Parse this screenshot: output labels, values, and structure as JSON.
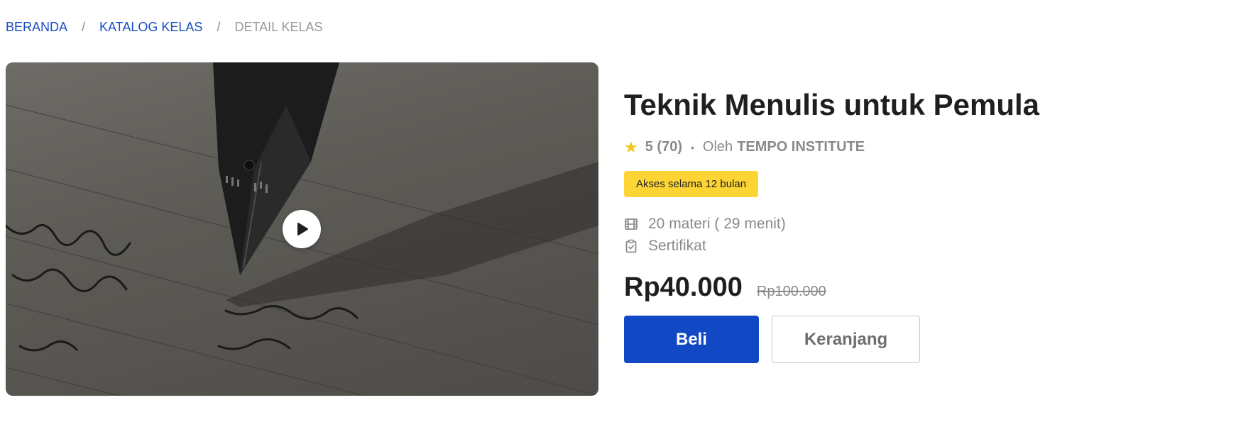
{
  "breadcrumb": {
    "home": "BERANDA",
    "catalog": "KATALOG KELAS",
    "current": "DETAIL KELAS",
    "separator": "/"
  },
  "course": {
    "title": "Teknik Menulis untuk Pemula",
    "rating": "5 (70)",
    "instructor_prefix": "Oleh",
    "instructor": "TEMPO INSTITUTE",
    "access_badge": "Akses selama 12 bulan",
    "materials": "20 materi ( 29 menit)",
    "certificate": "Sertifikat",
    "price": "Rp40.000",
    "original_price": "Rp100.000"
  },
  "actions": {
    "buy_label": "Beli",
    "cart_label": "Keranjang"
  },
  "icons": {
    "rating": "star-icon",
    "materials": "film-icon",
    "certificate": "clipboard-check-icon",
    "video": "play-icon"
  },
  "colors": {
    "primary": "#1148c4",
    "link": "#1a4fc4",
    "badge": "#fcd535",
    "star": "#f5c518"
  }
}
